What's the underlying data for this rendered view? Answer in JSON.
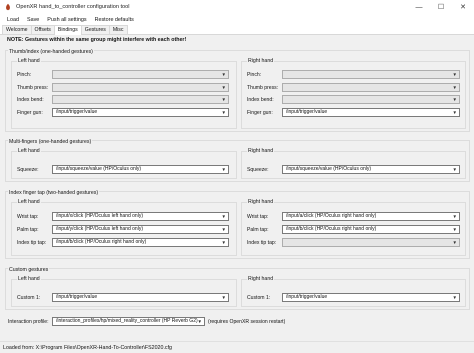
{
  "window": {
    "title": "OpenXR hand_to_controller configuration tool",
    "controls": [
      "—",
      "☐",
      "✕"
    ]
  },
  "menu": [
    "Load",
    "Save",
    "Push all settings",
    "Restore defaults"
  ],
  "tabs": [
    {
      "label": "Welcome",
      "active": false
    },
    {
      "label": "Offsets",
      "active": false
    },
    {
      "label": "Bindings",
      "active": true
    },
    {
      "label": "Gestures",
      "active": false
    },
    {
      "label": "Misc",
      "active": false
    }
  ],
  "note": "NOTE: Gestures within the same group might interfere with each other!",
  "thumb_index": {
    "title": "Thumb/index (one-handed gestures)",
    "left": {
      "title": "Left hand",
      "pinch": "Pinch:",
      "pinch_val": "",
      "thumb": "Thumb press:",
      "thumb_val": "",
      "index": "Index bend:",
      "index_val": "",
      "finger": "Finger gun:",
      "finger_val": "/input/trigger/value"
    },
    "right": {
      "title": "Right hand",
      "pinch": "Pinch:",
      "pinch_val": "",
      "thumb": "Thumb press:",
      "thumb_val": "",
      "index": "Index bend:",
      "index_val": "",
      "finger": "Finger gun:",
      "finger_val": "/input/trigger/value"
    }
  },
  "multi": {
    "title": "Multi-fingers (one-handed gestures)",
    "left": {
      "title": "Left hand",
      "squeeze": "Squeeze:",
      "squeeze_val": "/input/squeeze/value (HP/Oculus only)"
    },
    "right": {
      "title": "Right hand",
      "squeeze": "Squeeze:",
      "squeeze_val": "/input/squeeze/value (HP/Oculus only)"
    }
  },
  "tap": {
    "title": "Index finger tap (two-handed gestures)",
    "left": {
      "title": "Left hand",
      "wrist": "Wrist tap:",
      "wrist_val": "/input/x/click (HP/Oculus left hand only)",
      "palm": "Palm tap:",
      "palm_val": "/input/y/click (HP/Oculus left hand only)",
      "index": "Index tip tap:",
      "index_val": "/input/b/click (HP/Oculus right hand only)"
    },
    "right": {
      "title": "Right hand",
      "wrist": "Wrist tap:",
      "wrist_val": "/input/a/click (HP/Oculus right hand only)",
      "palm": "Palm tap:",
      "palm_val": "/input/b/click (HP/Oculus right hand only)",
      "index": "Index tip tap:",
      "index_val": ""
    }
  },
  "custom": {
    "title": "Custom gestures",
    "left": {
      "title": "Left hand",
      "c1": "Custom 1:",
      "c1_val": "/input/trigger/value"
    },
    "right": {
      "title": "Right hand",
      "c1": "Custom 1:",
      "c1_val": "/input/trigger/value"
    }
  },
  "interaction": {
    "label": "Interaction profile:",
    "value": "/interaction_profiles/hp/mixed_reality_controller (HP Reverb G2)",
    "hint": "(requires OpenXR session restart)"
  },
  "status": "Loaded from: X:\\Program Files\\OpenXR-Hand-To-Controller\\FS2020.cfg"
}
